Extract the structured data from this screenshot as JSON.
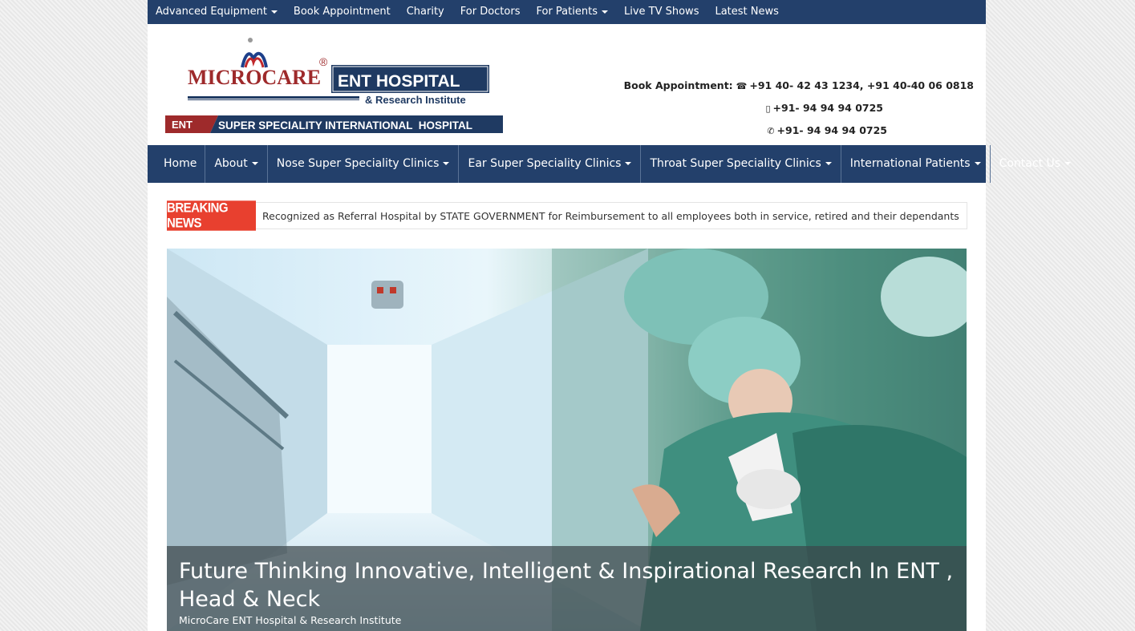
{
  "topnav": [
    {
      "label": "Advanced Equipment",
      "dropdown": true
    },
    {
      "label": "Book Appointment",
      "dropdown": false
    },
    {
      "label": "Charity",
      "dropdown": false
    },
    {
      "label": "For Doctors",
      "dropdown": false
    },
    {
      "label": "For Patients",
      "dropdown": true
    },
    {
      "label": "Live TV Shows",
      "dropdown": false
    },
    {
      "label": "Latest News",
      "dropdown": false
    }
  ],
  "logo": {
    "brand": "MICROCARE",
    "registered": "®",
    "hospital": "ENT HOSPITAL",
    "institute": "& Research Institute",
    "tag": "ENT",
    "tagline": "SUPER SPECIALITY INTERNATIONAL  HOSPITAL"
  },
  "contact": {
    "appointment_label": "Book Appointment:",
    "phones": "+91 40- 42 43 1234, +91 40-40 06 0818",
    "mobile": "+91- 94 94 94 0725",
    "whatsapp": "+91- 94 94 94 0725"
  },
  "mainnav": [
    {
      "label": "Home",
      "dropdown": false
    },
    {
      "label": "About",
      "dropdown": true
    },
    {
      "label": "Nose Super Speciality Clinics",
      "dropdown": true
    },
    {
      "label": "Ear Super Speciality Clinics",
      "dropdown": true
    },
    {
      "label": "Throat Super Speciality Clinics",
      "dropdown": true
    },
    {
      "label": "International Patients",
      "dropdown": true
    },
    {
      "label": "Contact Us",
      "dropdown": true
    }
  ],
  "breaking": {
    "label": "BREAKING NEWS",
    "text": "Recognized as Referral Hospital by STATE GOVERNMENT for Reimbursement to all employees both in service, retired and their dependants"
  },
  "hero": {
    "title": "Future Thinking Innovative, Intelligent & Inspirational Research In ENT , Head & Neck",
    "subtitle": "MicroCare ENT Hospital & Research Institute"
  },
  "colors": {
    "navy": "#23406b",
    "red": "#e8402f",
    "logo_red": "#9e2a2b"
  }
}
